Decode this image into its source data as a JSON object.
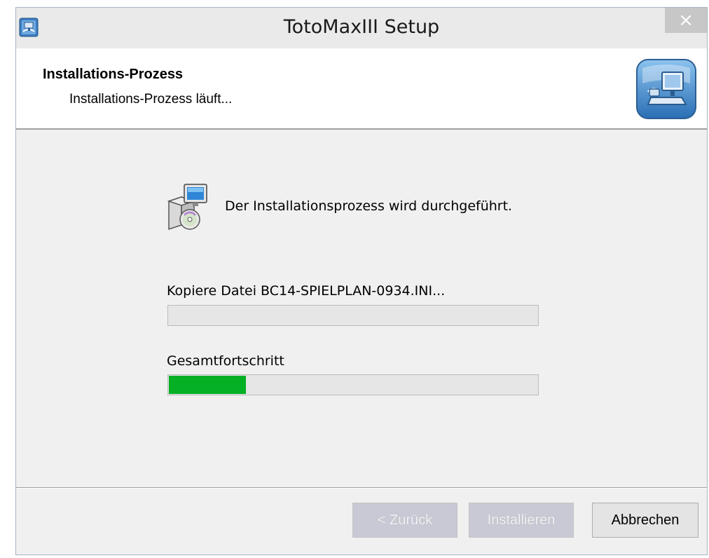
{
  "window": {
    "title": "TotoMaxIII Setup",
    "close_glyph": "×",
    "app_icon": "setup-app-icon"
  },
  "header": {
    "title": "Installations-Prozess",
    "subtitle": "Installations-Prozess läuft...",
    "logo_icon": "computer-install-logo-icon"
  },
  "content": {
    "status_icon": "installer-package-icon",
    "status_text": "Der Installationsprozess wird durchgeführt.",
    "current_file_label": "Kopiere Datei BC14-SPIELPLAN-0934.INI...",
    "current_file_progress": 0,
    "total_label": "Gesamtfortschritt",
    "total_progress": 0.21,
    "progress_color": "#06b025"
  },
  "buttons": {
    "back": {
      "label": "< Zurück",
      "enabled": false
    },
    "install": {
      "label": "Installieren",
      "enabled": false
    },
    "cancel": {
      "label": "Abbrechen",
      "enabled": true
    }
  },
  "colors": {
    "window_bg": "#f0f0f0",
    "header_bg": "#ffffff",
    "titlebar_bg": "#eaeaea",
    "close_bg": "#c7c7c7",
    "disabled_button_bg": "#c9c9d6"
  }
}
